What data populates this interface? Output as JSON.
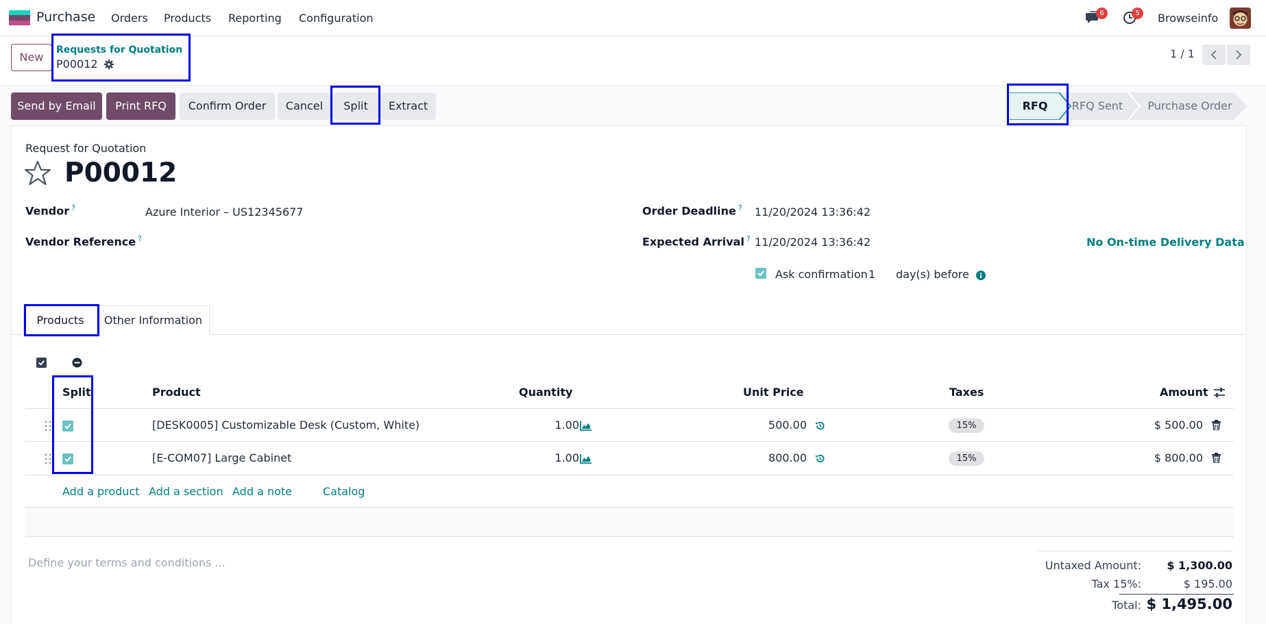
{
  "topnav": {
    "app_name": "Purchase",
    "menu": [
      "Orders",
      "Products",
      "Reporting",
      "Configuration"
    ],
    "messages_count": "6",
    "activities_count": "5",
    "company": "Browseinfo"
  },
  "control_panel": {
    "new_label": "New",
    "breadcrumb": "Requests for Quotation",
    "record_name": "P00012",
    "pager": "1 / 1"
  },
  "actions": {
    "send_email": "Send by Email",
    "print_rfq": "Print RFQ",
    "confirm_order": "Confirm Order",
    "cancel": "Cancel",
    "split": "Split",
    "extract": "Extract"
  },
  "stages": [
    "RFQ",
    "RFQ Sent",
    "Purchase Order"
  ],
  "form": {
    "doc_type": "Request for Quotation",
    "title": "P00012",
    "vendor_label": "Vendor",
    "vendor_value": "Azure Interior – US12345677",
    "vendor_ref_label": "Vendor Reference",
    "deadline_label": "Order Deadline",
    "deadline_value": "11/20/2024 13:36:42",
    "arrival_label": "Expected Arrival",
    "arrival_value": "11/20/2024 13:36:42",
    "delivery_data": "No On-time Delivery Data",
    "ask_confirm_label": "Ask confirmation",
    "ask_confirm_days": "1",
    "days_before": "day(s) before",
    "help_mark": "?"
  },
  "tabs": [
    "Products",
    "Other Information"
  ],
  "table": {
    "headers": {
      "split": "Split",
      "product": "Product",
      "quantity": "Quantity",
      "unit_price": "Unit Price",
      "taxes": "Taxes",
      "amount": "Amount"
    },
    "rows": [
      {
        "product": "[DESK0005] Customizable Desk (Custom, White)",
        "quantity": "1.00",
        "unit_price": "500.00",
        "tax": "15%",
        "amount": "$ 500.00"
      },
      {
        "product": "[E-COM07] Large Cabinet",
        "quantity": "1.00",
        "unit_price": "800.00",
        "tax": "15%",
        "amount": "$ 800.00"
      }
    ],
    "add_product": "Add a product",
    "add_section": "Add a section",
    "add_note": "Add a note",
    "catalog": "Catalog"
  },
  "terms_placeholder": "Define your terms and conditions ...",
  "totals": {
    "untaxed_label": "Untaxed Amount:",
    "untaxed_value": "$ 1,300.00",
    "tax_label": "Tax 15%:",
    "tax_value": "$ 195.00",
    "total_label": "Total:",
    "total_value": "$ 1,495.00"
  },
  "colors": {
    "primary": "#714b67",
    "teal": "#017e84",
    "highlight": "#0000e6"
  }
}
